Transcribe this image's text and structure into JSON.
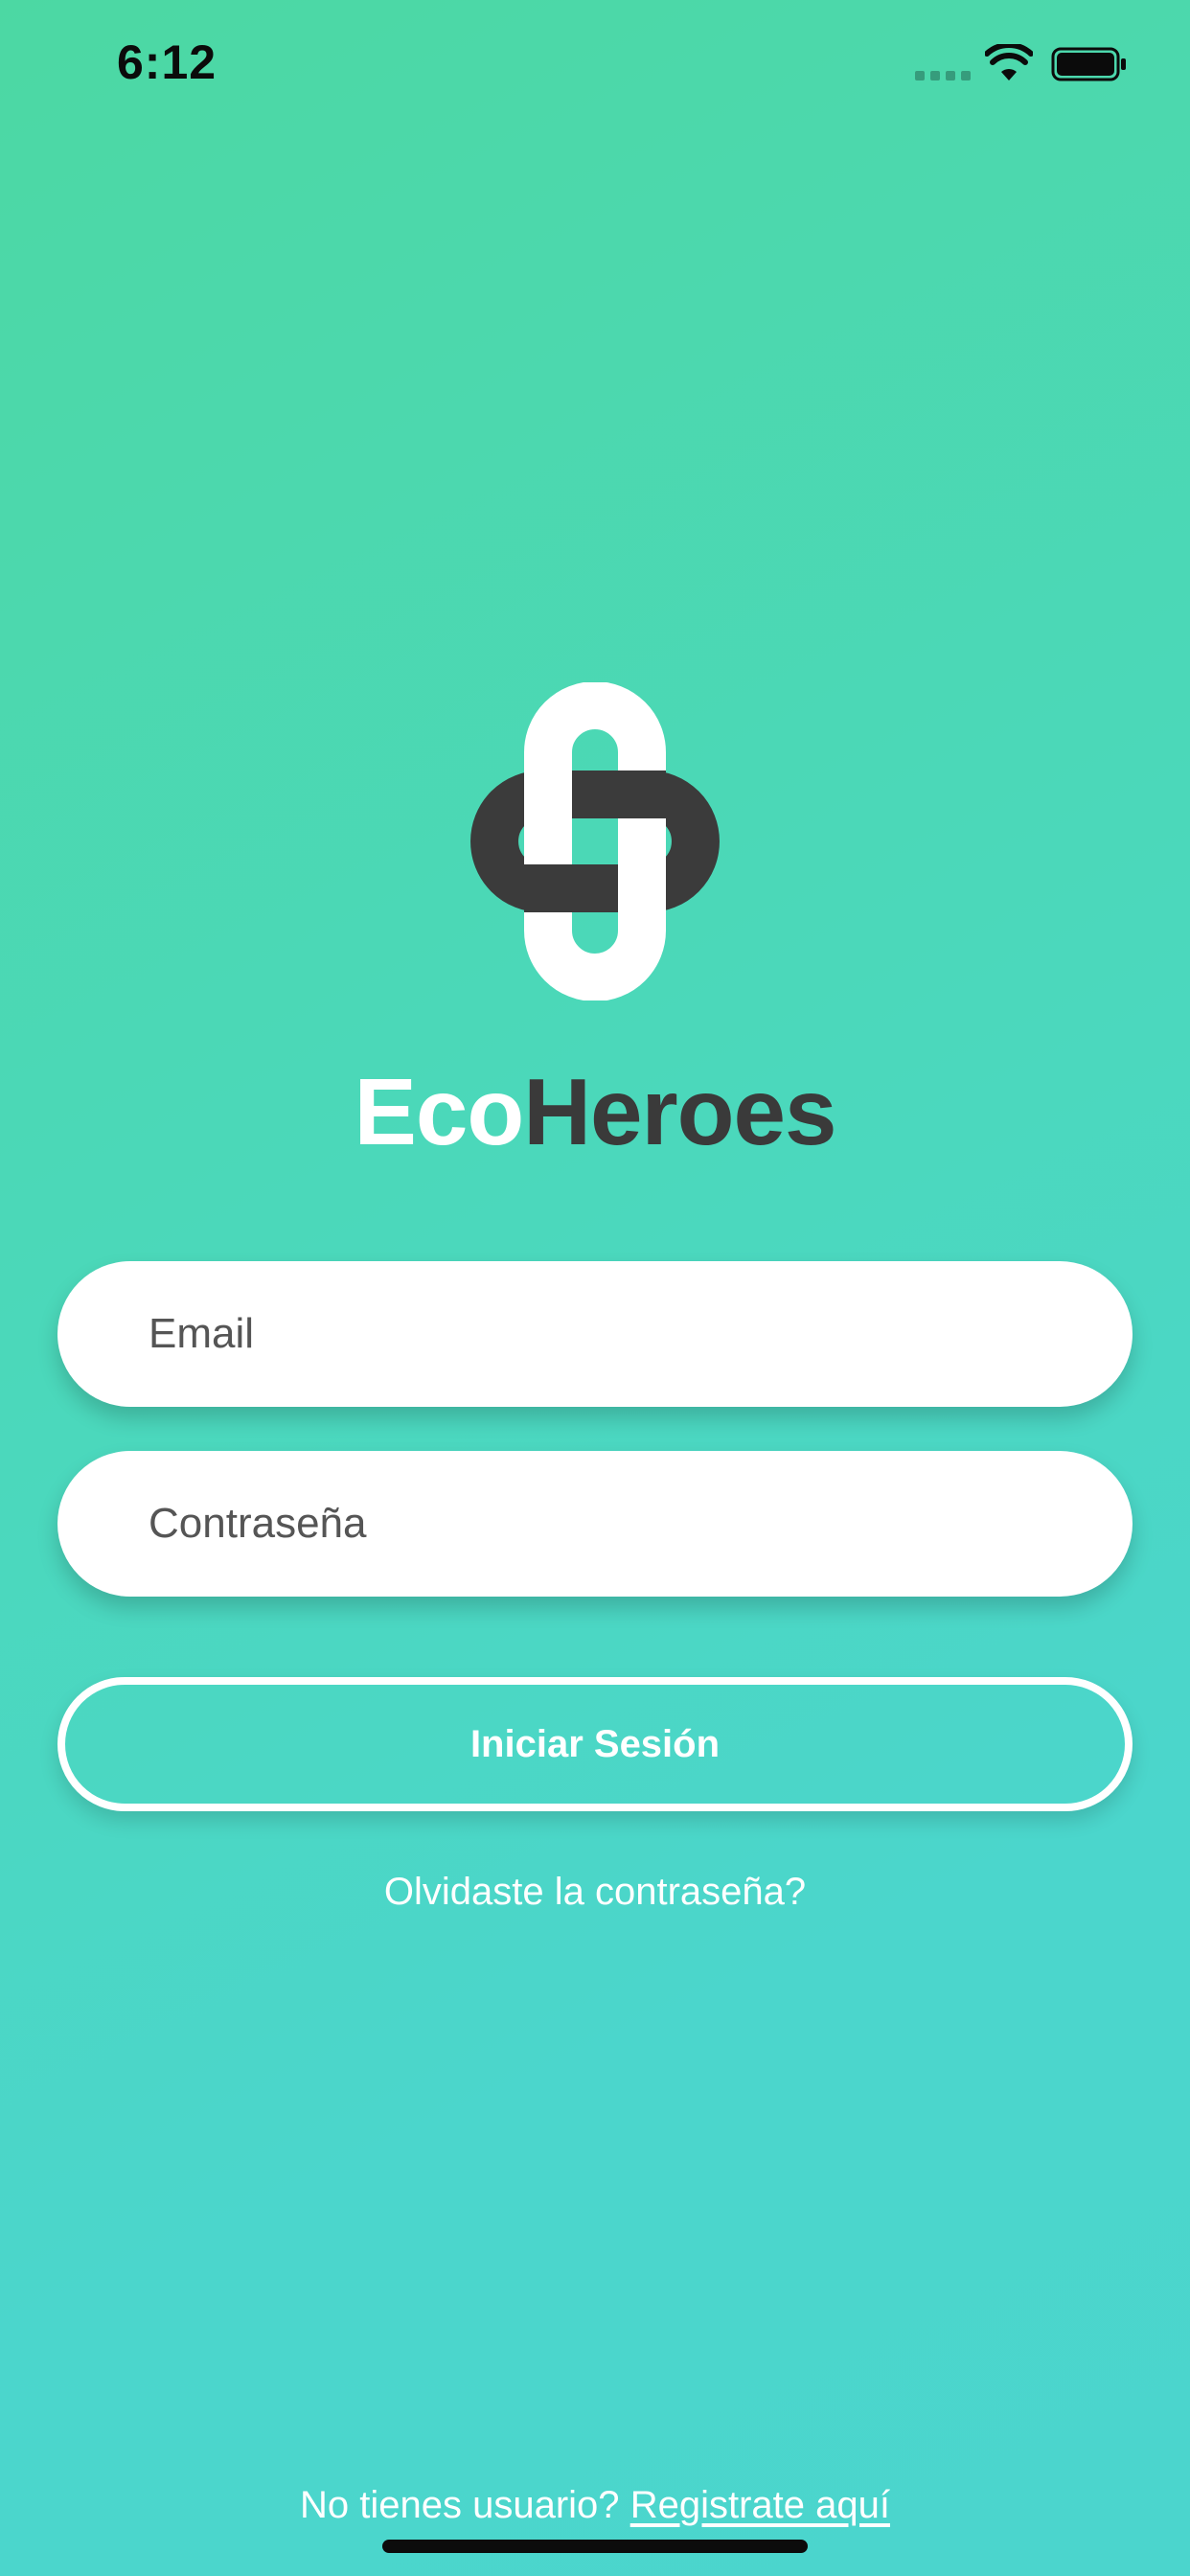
{
  "status_bar": {
    "time": "6:12",
    "signal_icon": "cellular-signal-icon",
    "wifi_icon": "wifi-icon",
    "battery_icon": "battery-full-icon"
  },
  "brand": {
    "logo_icon": "ecoheroes-cross-logo",
    "name_part1": "Eco",
    "name_part2": "Heroes",
    "color_light": "#ffffff",
    "color_dark": "#3a3a3a"
  },
  "form": {
    "email_placeholder": "Email",
    "password_placeholder": "Contraseña",
    "login_label": "Iniciar Sesión",
    "forgot_label": "Olvidaste la contraseña?"
  },
  "footer": {
    "register_prompt": "No tienes usuario?",
    "register_link": "Registrate aquí"
  },
  "colors": {
    "background_top": "#4cd8a3",
    "background_bottom": "#4bd5cd"
  }
}
